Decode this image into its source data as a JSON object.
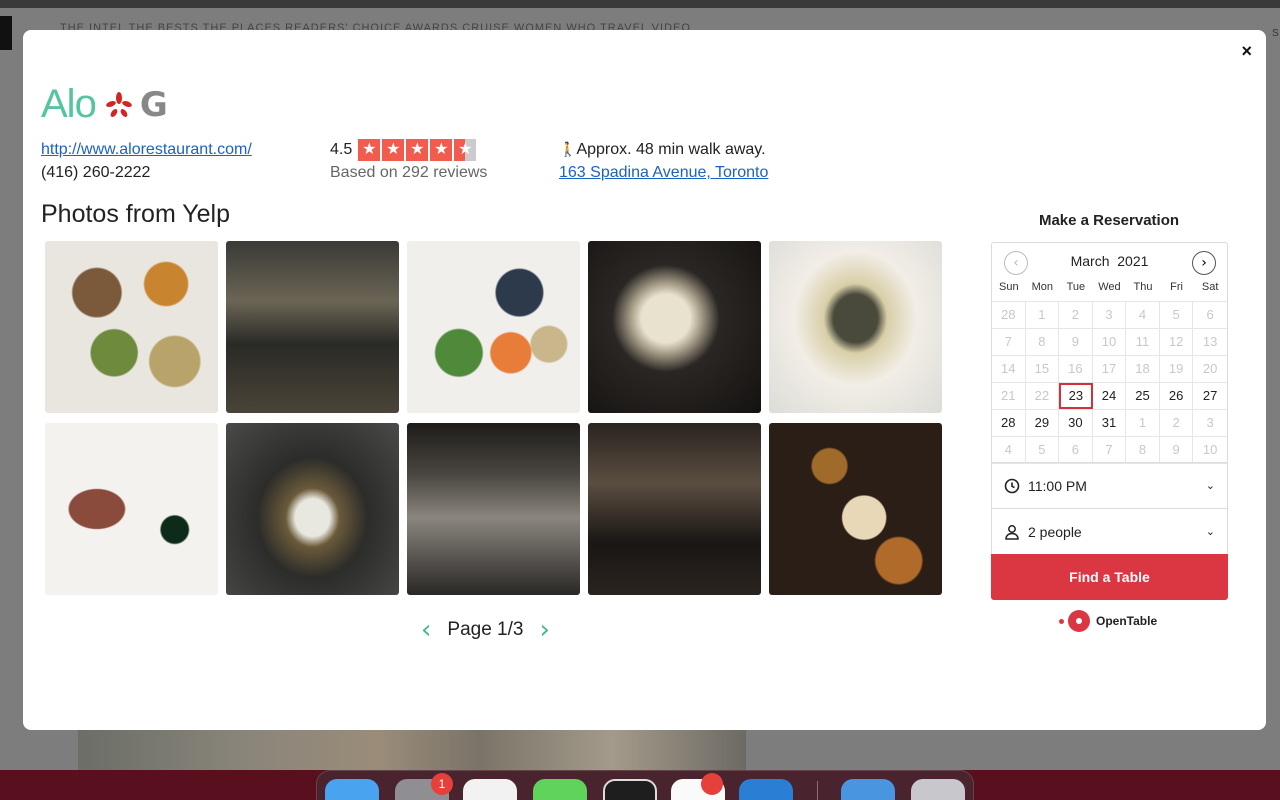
{
  "background": {
    "nav_text": "THE INTEL   THE BESTS   THE PLACES   READERS' CHOICE AWARDS   CRUISE   WOMEN WHO TRAVEL   VIDEO",
    "right_text": "S"
  },
  "modal": {
    "close_label": "×",
    "restaurant_name": "Alo",
    "website": "http://www.alorestaurant.com/",
    "phone": "(416) 260-2222",
    "rating": "4.5",
    "reviews_text": "Based on 292 reviews",
    "walk_text": "Approx. 48 min walk away.",
    "address": "163 Spadina Avenue, Toronto",
    "google_icon_letter": "G",
    "star_glyph": "★",
    "walk_glyph": "🚶",
    "photos_title": "Photos from Yelp",
    "page_label": "Page 1/3",
    "prev_glyph": "‹",
    "next_glyph": "›"
  },
  "photos": [
    {
      "name": "photo-1",
      "desc": "Assorted dishes on white plates"
    },
    {
      "name": "photo-2",
      "desc": "Restaurant dining room"
    },
    {
      "name": "photo-3",
      "desc": "Tasting menu spread"
    },
    {
      "name": "photo-4",
      "desc": "Oyster on dark plate"
    },
    {
      "name": "photo-5",
      "desc": "Dish with foam"
    },
    {
      "name": "photo-6",
      "desc": "Meat with green sauce"
    },
    {
      "name": "photo-7",
      "desc": "Plated dish with shaved garnish"
    },
    {
      "name": "photo-8",
      "desc": "Open kitchen"
    },
    {
      "name": "photo-9",
      "desc": "Kitchen counter at night"
    },
    {
      "name": "photo-10",
      "desc": "Table with drinks and dishes"
    }
  ],
  "reservation": {
    "title": "Make a Reservation",
    "month": "March",
    "year": "2021",
    "prev_glyph": "‹",
    "next_glyph": "›",
    "weekdays": [
      "Sun",
      "Mon",
      "Tue",
      "Wed",
      "Thu",
      "Fri",
      "Sat"
    ],
    "weeks": [
      [
        {
          "d": "28",
          "dim": true
        },
        {
          "d": "1",
          "dim": true
        },
        {
          "d": "2",
          "dim": true
        },
        {
          "d": "3",
          "dim": true
        },
        {
          "d": "4",
          "dim": true
        },
        {
          "d": "5",
          "dim": true
        },
        {
          "d": "6",
          "dim": true
        }
      ],
      [
        {
          "d": "7",
          "dim": true
        },
        {
          "d": "8",
          "dim": true
        },
        {
          "d": "9",
          "dim": true
        },
        {
          "d": "10",
          "dim": true
        },
        {
          "d": "11",
          "dim": true
        },
        {
          "d": "12",
          "dim": true
        },
        {
          "d": "13",
          "dim": true
        }
      ],
      [
        {
          "d": "14",
          "dim": true
        },
        {
          "d": "15",
          "dim": true
        },
        {
          "d": "16",
          "dim": true
        },
        {
          "d": "17",
          "dim": true
        },
        {
          "d": "18",
          "dim": true
        },
        {
          "d": "19",
          "dim": true
        },
        {
          "d": "20",
          "dim": true
        }
      ],
      [
        {
          "d": "21",
          "dim": true
        },
        {
          "d": "22",
          "dim": true
        },
        {
          "d": "23",
          "today": true
        },
        {
          "d": "24"
        },
        {
          "d": "25"
        },
        {
          "d": "26"
        },
        {
          "d": "27"
        }
      ],
      [
        {
          "d": "28"
        },
        {
          "d": "29"
        },
        {
          "d": "30"
        },
        {
          "d": "31"
        },
        {
          "d": "1",
          "dim": true
        },
        {
          "d": "2",
          "dim": true
        },
        {
          "d": "3",
          "dim": true
        }
      ],
      [
        {
          "d": "4",
          "dim": true
        },
        {
          "d": "5",
          "dim": true
        },
        {
          "d": "6",
          "dim": true
        },
        {
          "d": "7",
          "dim": true
        },
        {
          "d": "8",
          "dim": true
        },
        {
          "d": "9",
          "dim": true
        },
        {
          "d": "10",
          "dim": true
        }
      ]
    ],
    "time": "11:00 PM",
    "party": "2 people",
    "caret_glyph": "⌄",
    "button_label": "Find a Table",
    "brand": "OpenTable"
  },
  "dock": {
    "badges": [
      "1"
    ]
  },
  "colors": {
    "accent": "#55c4a1",
    "yelp_red": "#f15c4f",
    "opentable_red": "#da3743",
    "link_blue": "#1a62c6"
  }
}
